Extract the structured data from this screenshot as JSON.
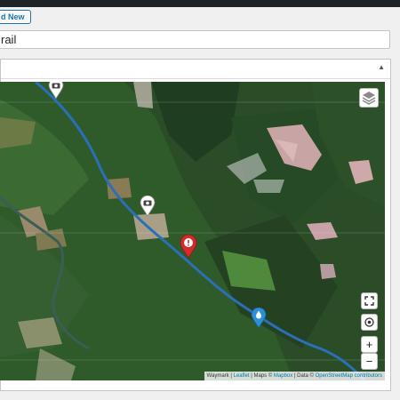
{
  "header": {
    "add_new_label": "d New"
  },
  "title_field": {
    "value": "rail"
  },
  "panel": {
    "toggle_icon": "triangle-up-icon"
  },
  "map": {
    "route_color": "#2a6fb8",
    "markers": [
      {
        "name": "photo-marker",
        "icon": "camera-icon",
        "color": "#ffffff"
      },
      {
        "name": "photo-marker",
        "icon": "camera-icon",
        "color": "#ffffff"
      },
      {
        "name": "alert-marker",
        "icon": "exclamation-icon",
        "color": "#d52a2a"
      },
      {
        "name": "water-marker",
        "icon": "water-drop-icon",
        "color": "#2d8fd6"
      }
    ],
    "controls": {
      "layers": "layers-icon",
      "fullscreen": "fullscreen-icon",
      "locate": "locate-icon",
      "zoom_in": "+",
      "zoom_out": "−"
    },
    "attribution": {
      "waymark": "Waymark |",
      "leaflet": "Leaflet",
      "maps": "| Maps ©",
      "mapbox": "Mapbox",
      "data": "| Data ©",
      "osm": "OpenStreetMap contributors"
    }
  }
}
